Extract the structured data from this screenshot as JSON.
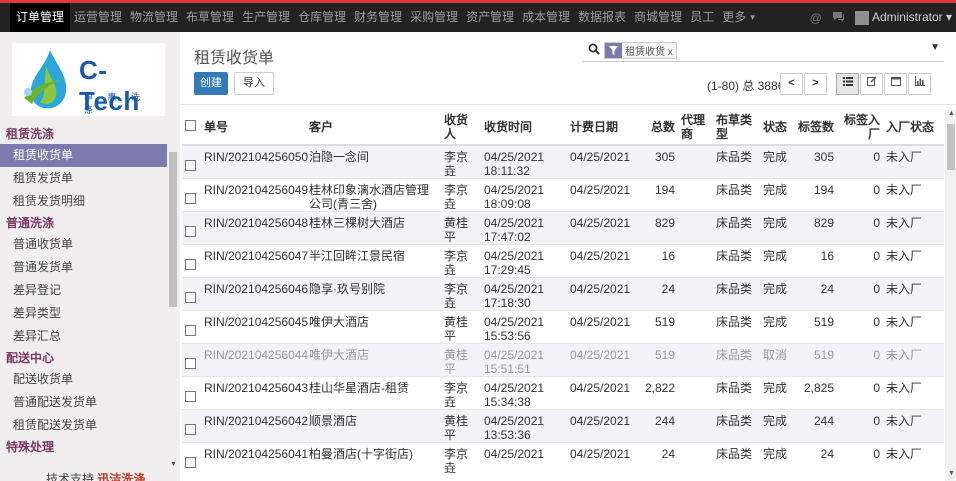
{
  "topnav": {
    "items": [
      {
        "label": "订单管理",
        "active": true
      },
      {
        "label": "运营管理"
      },
      {
        "label": "物流管理"
      },
      {
        "label": "布草管理"
      },
      {
        "label": "生产管理"
      },
      {
        "label": "仓库管理"
      },
      {
        "label": "财务管理"
      },
      {
        "label": "采购管理"
      },
      {
        "label": "资产管理"
      },
      {
        "label": "成本管理"
      },
      {
        "label": "数据报表"
      },
      {
        "label": "商城管理"
      },
      {
        "label": "员工"
      },
      {
        "label": "更多"
      }
    ],
    "more_caret": "▾",
    "user_name": "Administrator",
    "user_caret": "▾"
  },
  "logo": {
    "name": "C-Tech",
    "subtitle": "卓 惠 洗 涤"
  },
  "sidebar": {
    "groups": [
      {
        "title": "租赁洗涤",
        "items": [
          "租赁收货单",
          "租赁发货单",
          "租赁发货明细"
        ]
      },
      {
        "title": "普通洗涤",
        "items": [
          "普通收货单",
          "普通发货单",
          "差异登记",
          "差异类型",
          "差异汇总"
        ]
      },
      {
        "title": "配送中心",
        "items": [
          "配送收货单",
          "普通配送发货单",
          "租赁配送发货单"
        ]
      },
      {
        "title": "特殊处理",
        "items": []
      }
    ],
    "selected": "租赁收货单",
    "support_prefix": "技术支持",
    "support_brand": "迅洁洗涤"
  },
  "page": {
    "title": "租赁收货单",
    "create_label": "创建",
    "import_label": "导入"
  },
  "search": {
    "facet_label": "租赁收货 x"
  },
  "pager": {
    "info": "(1-80) 总 3886",
    "prev": "<",
    "next": ">"
  },
  "table": {
    "columns": [
      "单号",
      "客户",
      "收货人",
      "收货时间",
      "计费日期",
      "总数",
      "代理商",
      "布草类型",
      "状态",
      "标签数",
      "标签入厂",
      "入厂状态"
    ],
    "rows": [
      {
        "no": "RIN/202104256050",
        "customer": "泊隐一念间",
        "receiver": "李京垚",
        "date": "04/25/2021",
        "time": "18:11:32",
        "bill_date": "04/25/2021",
        "total": "305",
        "agent": "",
        "type": "床品类",
        "status": "完成",
        "tags": "305",
        "tag_in": "0",
        "in_status": "未入厂"
      },
      {
        "no": "RIN/202104256049",
        "customer": "桂林印象漓水酒店管理公司(青三舍)",
        "receiver": "李京垚",
        "date": "04/25/2021",
        "time": "18:09:08",
        "bill_date": "04/25/2021",
        "total": "194",
        "agent": "",
        "type": "床品类",
        "status": "完成",
        "tags": "194",
        "tag_in": "0",
        "in_status": "未入厂"
      },
      {
        "no": "RIN/202104256048",
        "customer": "桂林三棵树大酒店",
        "receiver": "黄桂平",
        "date": "04/25/2021",
        "time": "17:47:02",
        "bill_date": "04/25/2021",
        "total": "829",
        "agent": "",
        "type": "床品类",
        "status": "完成",
        "tags": "829",
        "tag_in": "0",
        "in_status": "未入厂"
      },
      {
        "no": "RIN/202104256047",
        "customer": "半江回眸江景民宿",
        "receiver": "李京垚",
        "date": "04/25/2021",
        "time": "17:29:45",
        "bill_date": "04/25/2021",
        "total": "16",
        "agent": "",
        "type": "床品类",
        "status": "完成",
        "tags": "16",
        "tag_in": "0",
        "in_status": "未入厂"
      },
      {
        "no": "RIN/202104256046",
        "customer": "隐享·玖号别院",
        "receiver": "李京垚",
        "date": "04/25/2021",
        "time": "17:18:30",
        "bill_date": "04/25/2021",
        "total": "24",
        "agent": "",
        "type": "床品类",
        "status": "完成",
        "tags": "24",
        "tag_in": "0",
        "in_status": "未入厂"
      },
      {
        "no": "RIN/202104256045",
        "customer": "唯伊大酒店",
        "receiver": "黄桂平",
        "date": "04/25/2021",
        "time": "15:53:56",
        "bill_date": "04/25/2021",
        "total": "519",
        "agent": "",
        "type": "床品类",
        "status": "完成",
        "tags": "519",
        "tag_in": "0",
        "in_status": "未入厂"
      },
      {
        "no": "RIN/202104256044",
        "customer": "唯伊大酒店",
        "receiver": "黄桂平",
        "date": "04/25/2021",
        "time": "15:51:51",
        "bill_date": "04/25/2021",
        "total": "519",
        "agent": "",
        "type": "床品类",
        "status": "取消",
        "tags": "519",
        "tag_in": "0",
        "in_status": "未入厂",
        "cancelled": true
      },
      {
        "no": "RIN/202104256043",
        "customer": "桂山华星酒店-租赁",
        "receiver": "李京垚",
        "date": "04/25/2021",
        "time": "15:34:38",
        "bill_date": "04/25/2021",
        "total": "2,822",
        "agent": "",
        "type": "床品类",
        "status": "完成",
        "tags": "2,825",
        "tag_in": "0",
        "in_status": "未入厂"
      },
      {
        "no": "RIN/202104256042",
        "customer": "顺景酒店",
        "receiver": "黄桂平",
        "date": "04/25/2021",
        "time": "13:53:36",
        "bill_date": "04/25/2021",
        "total": "244",
        "agent": "",
        "type": "床品类",
        "status": "完成",
        "tags": "244",
        "tag_in": "0",
        "in_status": "未入厂"
      },
      {
        "no": "RIN/202104256041",
        "customer": "柏曼酒店(十字街店)",
        "receiver": "李京垚",
        "date": "04/25/2021",
        "time": "",
        "bill_date": "04/25/2021",
        "total": "24",
        "agent": "",
        "type": "床品类",
        "status": "完成",
        "tags": "24",
        "tag_in": "0",
        "in_status": "未入厂"
      }
    ]
  },
  "colors": {
    "topbar": "#222222",
    "topbar_accent": "#e0383e",
    "primary": "#337ab7",
    "sidebar_bg": "#f0eeee",
    "sidebar_selected": "#7c7bad",
    "group_title": "#7c3a66"
  }
}
